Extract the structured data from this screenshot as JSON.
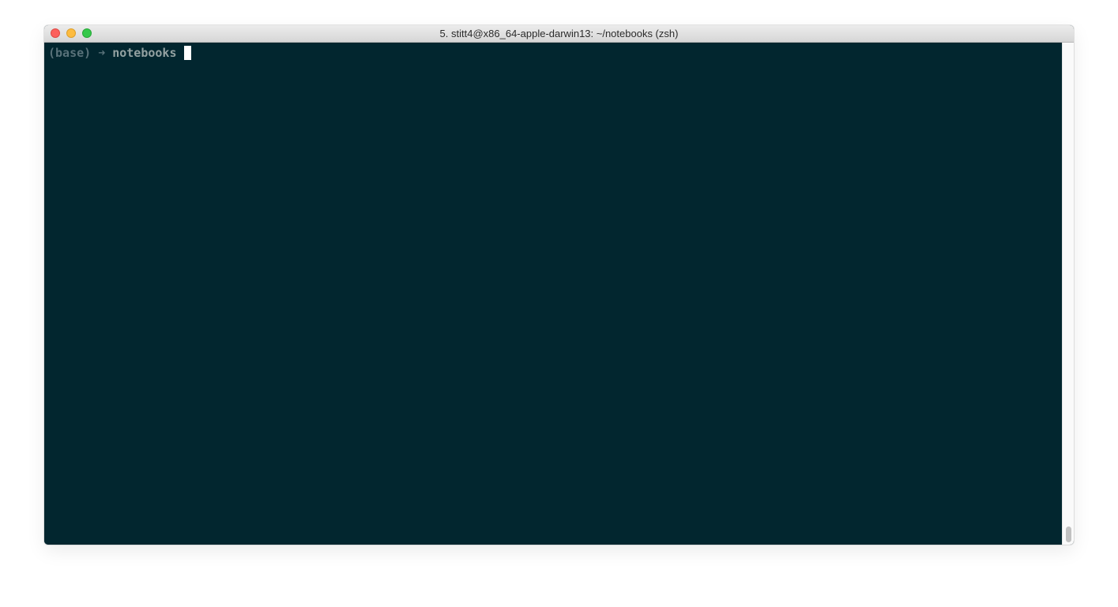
{
  "window": {
    "title": "5. stitt4@x86_64-apple-darwin13: ~/notebooks (zsh)"
  },
  "terminal": {
    "env_label": "(base)",
    "arrow_glyph": "➜",
    "cwd": "notebooks"
  },
  "colors": {
    "terminal_background": "#02262f",
    "prompt_text": "#93a1a1",
    "prompt_dim": "#587179",
    "cursor": "#ffffff",
    "close_button": "#fc605c",
    "minimize_button": "#fdbc40",
    "zoom_button": "#34c84a"
  },
  "icons": {
    "close": "close-button-icon",
    "minimize": "minimize-button-icon",
    "zoom": "zoom-button-icon"
  }
}
